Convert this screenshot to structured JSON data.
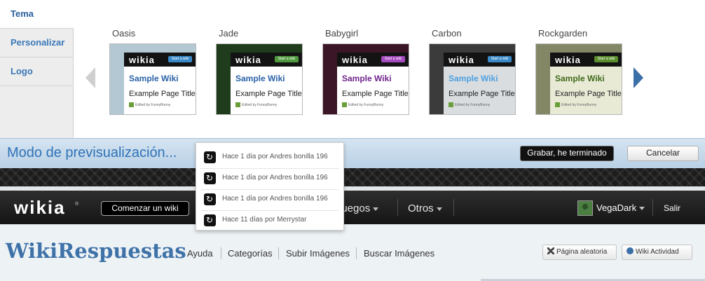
{
  "designer": {
    "tabs": [
      "Tema",
      "Personalizar",
      "Logo"
    ],
    "themes": [
      {
        "name": "Oasis",
        "bg": "#b4c8d4",
        "titleColor": "#2a62a8",
        "btnColor": "#3a8ac9"
      },
      {
        "name": "Jade",
        "bg": "#1f3d1c",
        "titleColor": "#2a62a8",
        "btnColor": "#4f9a3e"
      },
      {
        "name": "Babygirl",
        "bg": "#3a1627",
        "titleColor": "#70248c",
        "btnColor": "#a54bbf"
      },
      {
        "name": "Carbon",
        "bg": "#3b3b3b",
        "titleColor": "#4ea0e0",
        "btnColor": "#3a8ac9"
      },
      {
        "name": "Rockgarden",
        "bg": "#838766",
        "titleColor": "#3f6a1a",
        "btnColor": "#5b8f2e"
      }
    ],
    "thumbnail": {
      "logo": "wikia",
      "start_button": "Start a wiki",
      "wiki_name": "Sample Wiki",
      "page_title": "Example Page Title",
      "edited_by": "Edited by FunnyBunny"
    }
  },
  "preview": {
    "title": "Modo de previsualización...",
    "save_label": "Grabar, he terminado",
    "cancel_label": "Cancelar"
  },
  "global_nav": {
    "logo": "wikia",
    "trademark": "®",
    "start_wiki_label": "Comenzar un wiki",
    "menu_videojuegos": "juegos",
    "menu_otros": "Otros",
    "user_name": "VegaDark",
    "logout_label": "Salir"
  },
  "wiki_header": {
    "title": "WikiRespuestas",
    "nav": [
      "Ayuda",
      "Categorías",
      "Subir Imágenes",
      "Buscar Imágenes"
    ],
    "random_page": "Página aleatoria",
    "wiki_activity": "Wiki Actividad"
  },
  "activity_dropdown": {
    "items": [
      "Hace 1 día por Andres bonilla 196",
      "Hace 1 día por Andres bonilla 196",
      "Hace 1 día por Andres bonilla 196",
      "Hace 11 días por Merrystar"
    ]
  }
}
